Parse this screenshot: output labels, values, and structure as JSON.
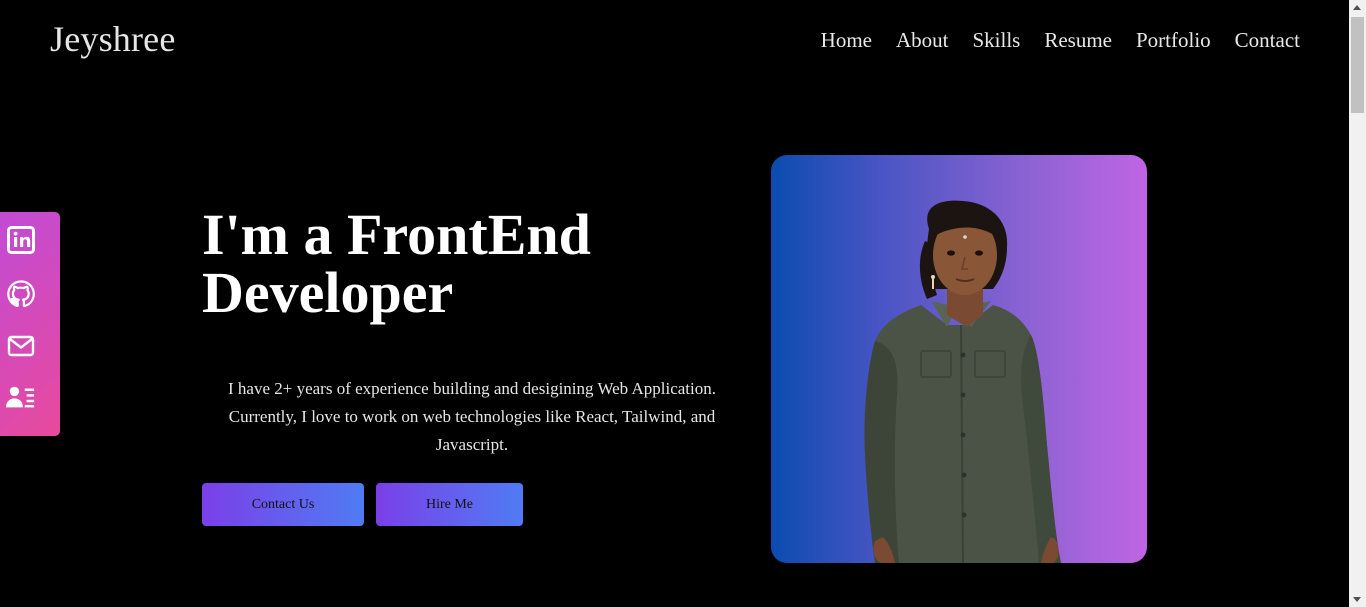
{
  "header": {
    "brand": "Jeyshree",
    "nav": [
      "Home",
      "About",
      "Skills",
      "Resume",
      "Portfolio",
      "Contact"
    ]
  },
  "social": {
    "icons": [
      "linkedin-icon",
      "github-icon",
      "mail-icon",
      "contact-card-icon"
    ]
  },
  "hero": {
    "title_line1": "I'm a FrontEnd",
    "title_line2": "Developer",
    "description_line1": "I have 2+ years of experience building and desigining Web Application.",
    "description_line2": "Currently, I love to work on web technologies like React, Tailwind, and",
    "description_line3": "Javascript.",
    "contact_label": "Contact Us",
    "hire_label": "Hire Me"
  },
  "colors": {
    "background": "#000000",
    "sidebar_gradient_start": "#c14bd6",
    "sidebar_gradient_end": "#e84a9c",
    "button_gradient_start": "#7b3fe8",
    "button_gradient_end": "#4f7cf4",
    "portrait_gradient_start": "#0b4cb0",
    "portrait_gradient_end": "#c064e4"
  }
}
